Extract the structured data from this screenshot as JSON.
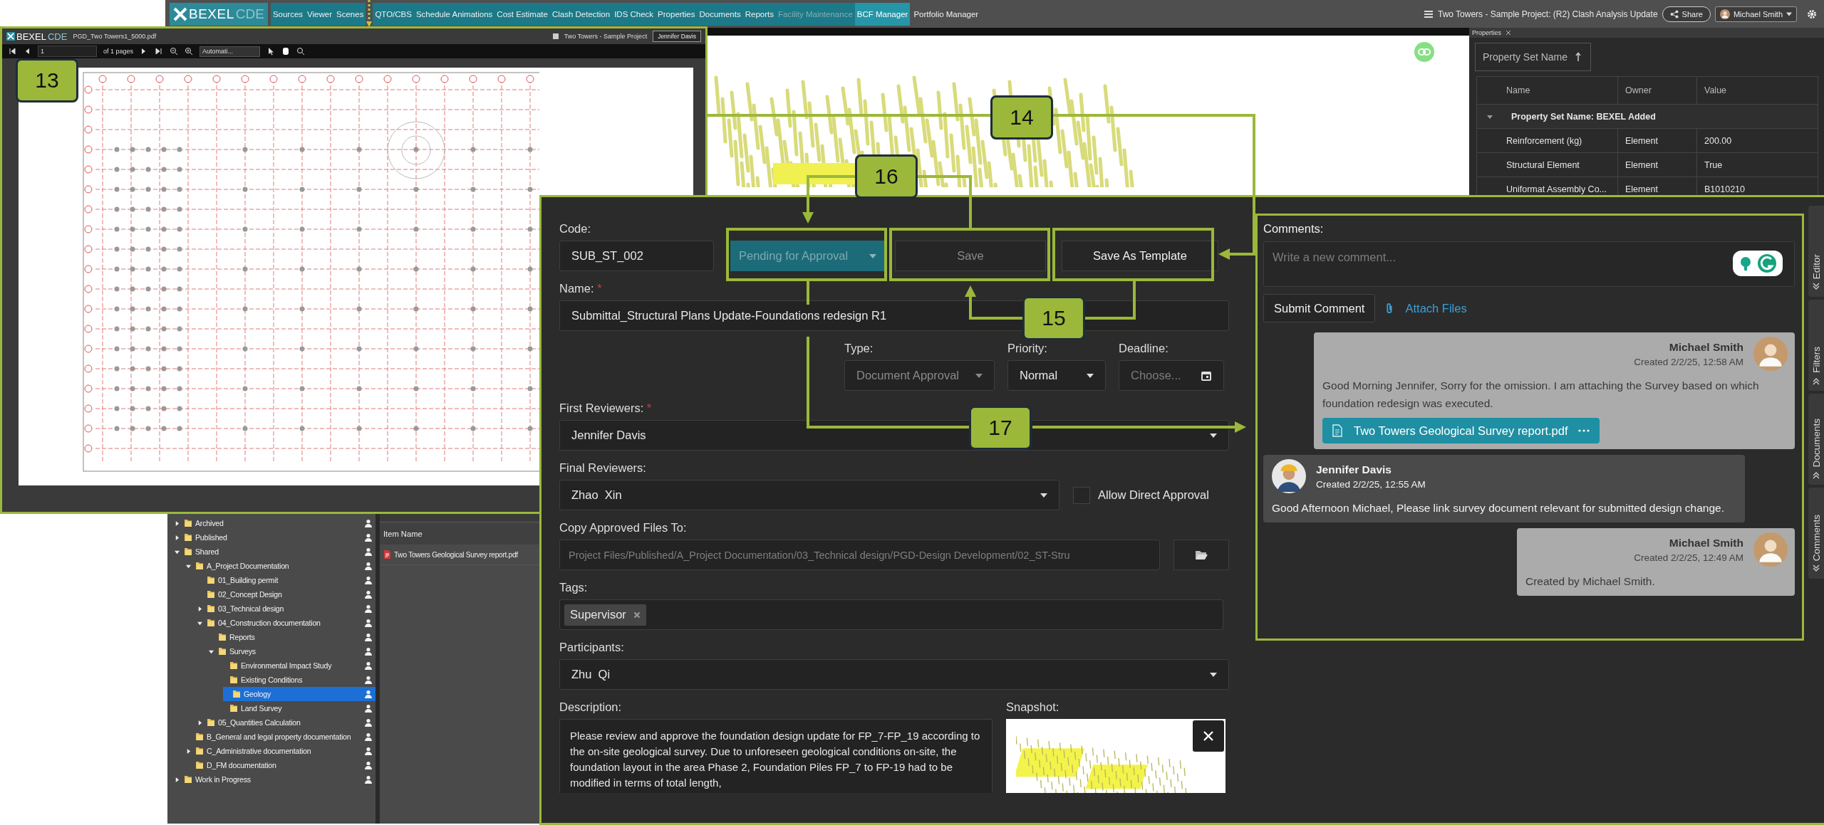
{
  "app_bar": {
    "logo": "BEXEL",
    "logo_suffix": "CDE",
    "nav": [
      {
        "label": "Sources",
        "selected": false,
        "disabled": false,
        "kind": "module"
      },
      {
        "label": "Viewer",
        "selected": false,
        "disabled": false,
        "kind": "module"
      },
      {
        "label": "Scenes",
        "selected": false,
        "disabled": false,
        "kind": "module"
      },
      {
        "label": "QTO/CBS",
        "selected": false,
        "disabled": false,
        "kind": "module"
      },
      {
        "label": "Schedule Animations",
        "selected": false,
        "disabled": false,
        "kind": "module"
      },
      {
        "label": "Cost Estimate",
        "selected": false,
        "disabled": false,
        "kind": "module"
      },
      {
        "label": "Clash Detection",
        "selected": false,
        "disabled": false,
        "kind": "module"
      },
      {
        "label": "IDS Check",
        "selected": false,
        "disabled": false,
        "kind": "module"
      },
      {
        "label": "Properties",
        "selected": false,
        "disabled": false,
        "kind": "module"
      },
      {
        "label": "Documents",
        "selected": false,
        "disabled": false,
        "kind": "module"
      },
      {
        "label": "Reports",
        "selected": false,
        "disabled": false,
        "kind": "module"
      },
      {
        "label": "Facility Maintenance",
        "selected": false,
        "disabled": true,
        "kind": "module"
      },
      {
        "label": "BCF Manager",
        "selected": true,
        "disabled": false,
        "kind": "module"
      },
      {
        "label": "Portfolio Manager",
        "selected": false,
        "disabled": false,
        "kind": "link"
      }
    ],
    "project": "Two Towers - Sample Project: (R2) Clash Analysis Update",
    "share": "Share",
    "user": "Michael Smith"
  },
  "pdf_viewer": {
    "logo": "BEXEL",
    "logo_suffix": "CDE",
    "file": "PGD_Two Towers1_5000.pdf",
    "project": "Two Towers - Sample Project",
    "user": "Jennifer Davis",
    "page": "1",
    "page_count": "of 1 pages",
    "zoom": "Automati..."
  },
  "properties": {
    "tab": "Properties",
    "sort_button": "Property Set Name",
    "columns": [
      "Name",
      "Owner",
      "Value"
    ],
    "group": {
      "label": "Property Set Name: BEXEL Added",
      "expanded": true
    },
    "rows": [
      [
        "Reinforcement (kg)",
        "Element",
        "200.00"
      ],
      [
        "Structural Element",
        "Element",
        "True"
      ],
      [
        "Uniformat Assembly Co...",
        "Element",
        "B1010210"
      ]
    ]
  },
  "documents": {
    "tree": [
      {
        "label": "Archived",
        "expanded": false,
        "selected": false
      },
      {
        "label": "Published",
        "expanded": false,
        "selected": false
      },
      {
        "label": "Shared",
        "expanded": true,
        "selected": false,
        "children": [
          {
            "label": "A_Project Documentation",
            "expanded": true,
            "selected": false,
            "children": [
              {
                "label": "01_Building permit",
                "selected": false
              },
              {
                "label": "02_Concept Design",
                "selected": false
              },
              {
                "label": "03_Technical design",
                "expanded": false,
                "selected": false
              },
              {
                "label": "04_Construction documentation",
                "expanded": true,
                "selected": false,
                "children": [
                  {
                    "label": "Reports",
                    "selected": false
                  },
                  {
                    "label": "Surveys",
                    "expanded": true,
                    "selected": false,
                    "children": [
                      {
                        "label": "Environmental Impact Study",
                        "selected": false
                      },
                      {
                        "label": "Existing Conditions",
                        "selected": false
                      },
                      {
                        "label": "Geology",
                        "selected": true
                      },
                      {
                        "label": "Land Survey",
                        "selected": false
                      }
                    ]
                  }
                ]
              },
              {
                "label": "05_Quantities Calculation",
                "expanded": false,
                "selected": false
              }
            ]
          },
          {
            "label": "B_General and legal property documentation",
            "selected": false
          },
          {
            "label": "C_Administrative documentation",
            "expanded": false,
            "selected": false
          },
          {
            "label": "D_FM documentation",
            "selected": false
          }
        ]
      },
      {
        "label": "Work in Progress",
        "expanded": false,
        "selected": false
      }
    ],
    "list_header": "Item Name",
    "files": [
      "Two Towers Geological Survey report.pdf"
    ]
  },
  "form": {
    "code": {
      "label": "Code:",
      "value": "SUB_ST_002"
    },
    "status": {
      "value": "Pending for Approval",
      "disabled": true
    },
    "save": {
      "label": "Save",
      "disabled": true
    },
    "save_template": {
      "label": "Save As Template",
      "disabled": false
    },
    "name": {
      "label": "Name:",
      "mark": "*",
      "value": "Submittal_Structural Plans Update-Foundations redesign R1"
    },
    "type": {
      "label": "Type:",
      "value": "Document Approval",
      "disabled": true
    },
    "priority": {
      "label": "Priority:",
      "value": "Normal",
      "disabled": false
    },
    "deadline": {
      "label": "Deadline:",
      "placeholder": "Choose..."
    },
    "first_reviewers": {
      "label": "First Reviewers:",
      "mark": "*",
      "value": "Jennifer Davis"
    },
    "final_reviewers": {
      "label": "Final Reviewers:",
      "value": "Zhao  Xin"
    },
    "allow_direct_approval": {
      "label": "Allow Direct Approval",
      "checked": false
    },
    "copy_to": {
      "label": "Copy Approved Files To:",
      "disabled": true,
      "value": "Project Files/Published/A_Project Documentation/03_Technical design/PGD-Design Development/02_ST-Stru"
    },
    "tags": {
      "label": "Tags:",
      "items": [
        "Supervisor"
      ]
    },
    "participants": {
      "label": "Participants:",
      "value": "Zhu  Qi"
    },
    "description": {
      "label": "Description:",
      "value": "Please review and approve the foundation design update for FP_7-FP_19 according to the on-site geological survey. Due to unforeseen geological conditions on-site, the foundation layout in the area Phase 2, Foundation Piles FP_7 to FP-19 had to be modified in terms of total length,"
    },
    "snapshot": {
      "label": "Snapshot:"
    }
  },
  "comments": {
    "label": "Comments:",
    "placeholder": "Write a new comment...",
    "submit": "Submit Comment",
    "attach": "Attach Files",
    "items": [
      {
        "kind": "own",
        "author": "Michael Smith",
        "created": "Created 2/2/25, 12:58 AM",
        "text": "Good Morning Jennifer, Sorry for the omission. I am attaching the Survey based on which foundation redesign was executed.",
        "attachment": "Two Towers Geological Survey report.pdf"
      },
      {
        "kind": "other",
        "author": "Jennifer Davis",
        "created": "Created 2/2/25, 12:55 AM",
        "text": "Good Afternoon Michael, Please link survey document relevant for submitted design change."
      },
      {
        "kind": "own",
        "author": "Michael Smith",
        "created": "Created 2/2/25, 12:49 AM",
        "text": "Created by Michael Smith."
      }
    ]
  },
  "side_tabs": [
    {
      "label": "Editor",
      "collapsed": false
    },
    {
      "label": "Filters",
      "collapsed": true
    },
    {
      "label": "Documents",
      "collapsed": true
    },
    {
      "label": "Comments",
      "collapsed": false
    }
  ],
  "callouts": [
    "13",
    "14",
    "16",
    "15",
    "17"
  ]
}
